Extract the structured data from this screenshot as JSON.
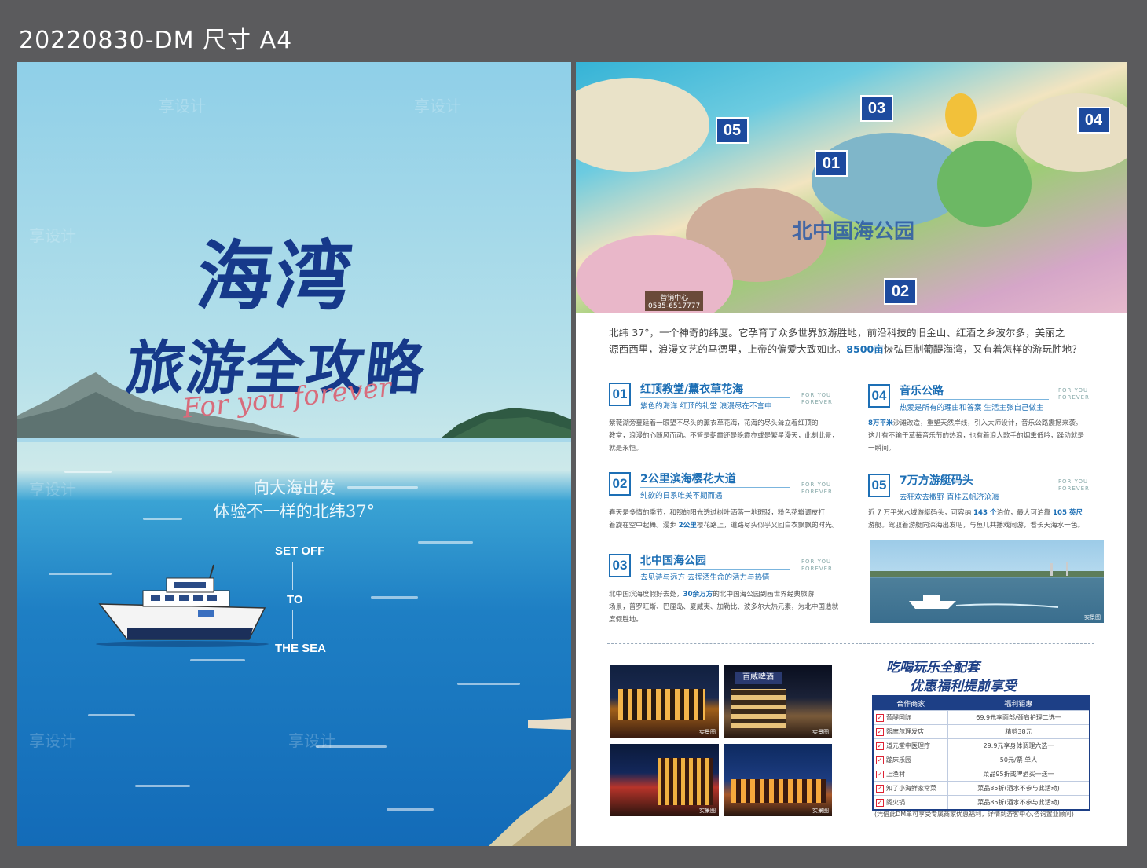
{
  "header": {
    "title": "20220830-DM 尺寸 A4"
  },
  "watermark": {
    "text": "享设计"
  },
  "cover": {
    "title_line1": "海湾",
    "title_line2": "旅游全攻略",
    "script_text": "For you forever",
    "slogan_line1": "向大海出发",
    "slogan_line2": "体验不一样的北纬37°",
    "set_off": "SET OFF",
    "to": "TO",
    "the_sea": "THE SEA"
  },
  "map": {
    "badges": [
      "05",
      "03",
      "04",
      "01",
      "02"
    ],
    "park_name": "北中国海公园",
    "sales_center": "营销中心",
    "phone": "0535-6517777"
  },
  "intro": {
    "line1": "北纬 37°，一个神奇的纬度。它孕育了众多世界旅游胜地，前沿科技的旧金山、红酒之乡波尔多，美丽之",
    "line2_a": "源西西里，浪漫文艺的马德里，上帝的偏爱大致如此。",
    "line2_b": "8500亩",
    "line2_c": "恢弘巨制葡醍海湾，又有着怎样的游玩胜地？"
  },
  "for_you_forever": "FOR YOU FOREVER",
  "items": [
    {
      "num": "01",
      "title": "红顶教堂/薰衣草花海",
      "sub": "紫色的海洋 红顶的礼堂 浪漫尽在不言中",
      "body1": "紫薇湖旁蔓延着一眼望不尽头的薰衣草花海，花海的尽头耸立着红顶的",
      "body2": "教堂，浪漫的心随风而动。不管是朝霞还是晚霞亦或是繁星漫天，此刻此景，",
      "body3": "就是永恒。"
    },
    {
      "num": "02",
      "title": "2公里滨海樱花大道",
      "sub": "纯欲的日系唯美不期而遇",
      "body1": "春天是多情的季节，和煦的阳光透过树叶洒落一地斑驳，粉色花瓣调皮打",
      "body2a": "着旋在空中起舞。漫步 ",
      "body2b": "2公里",
      "body2c": "樱花路上，道路尽头似乎又回白衣飘飘的时光。"
    },
    {
      "num": "03",
      "title": "北中国海公园",
      "sub": "去见诗与远方 去挥洒生命的活力与热情",
      "body1a": "北中国滨海度假好去处，",
      "body1b": "30余万方",
      "body1c": "的北中国海公园到画世界经典旅游",
      "body2": "场景，普罗旺斯、巴厘岛、夏威夷、加勒比、波多尔大热元素，为北中国造就",
      "body3": "度假胜地。"
    },
    {
      "num": "04",
      "title": "音乐公路",
      "sub": "热爱是所有的理由和答案 生活主张自己做主",
      "body1a": "8万平米",
      "body1b": "沙滩改造，重塑天然岸线，引入大师设计，音乐公路震撼来袭。",
      "body2": "这儿有不输于草莓音乐节的热浪，也有着浪人歌手的烟熏低吟，躁动就是",
      "body3": "一瞬间。"
    },
    {
      "num": "05",
      "title": "7万方游艇码头",
      "sub": "去狂欢去撒野 直挂云帆济沧海",
      "body1a": "近 7 万平米水域游艇码头，可容纳 ",
      "body1b": "143 个",
      "body1c": "泊位，最大可泊靠 ",
      "body1d": "105 英尺",
      "body2": "游艇。驾驭着游艇向深海出发吧，与鱼儿共播戏闹游，看长天海水一色。"
    }
  ],
  "photo_label": "实景图",
  "night_photos": [
    {
      "label": "实景图"
    },
    {
      "label": "实景图",
      "sign": "百威啤酒"
    },
    {
      "label": "实景图"
    },
    {
      "label": "实景图"
    }
  ],
  "perks": {
    "headline1": "吃喝玩乐全配套",
    "headline2": "优惠福利提前享受",
    "col_merchant": "合作商家",
    "col_benefit": "福利钜惠",
    "rows": [
      {
        "merchant": "葡醍国际",
        "benefit": "69.9元享面部/颈肩护理二选一"
      },
      {
        "merchant": "熙摩尔理发店",
        "benefit": "精剪38元"
      },
      {
        "merchant": "道元堂中医理疗",
        "benefit": "29.9元享身体调理六选一"
      },
      {
        "merchant": "蹦床乐园",
        "benefit": "50元/票 单人"
      },
      {
        "merchant": "上渔村",
        "benefit": "菜品95折或啤酒买一送一"
      },
      {
        "merchant": "知了小海鲜家常菜",
        "benefit": "菜品85折(酒水不参与此活动)"
      },
      {
        "merchant": "阁火锅",
        "benefit": "菜品85折(酒水不参与此活动)"
      }
    ],
    "note": "(凭借此DM单可享受专属商家优惠福利，详情到游客中心,咨询置业顾问)"
  },
  "colors": {
    "brand_blue": "#1d3f86",
    "accent_blue": "#1d6fb5",
    "background": "#5b5b5d"
  }
}
